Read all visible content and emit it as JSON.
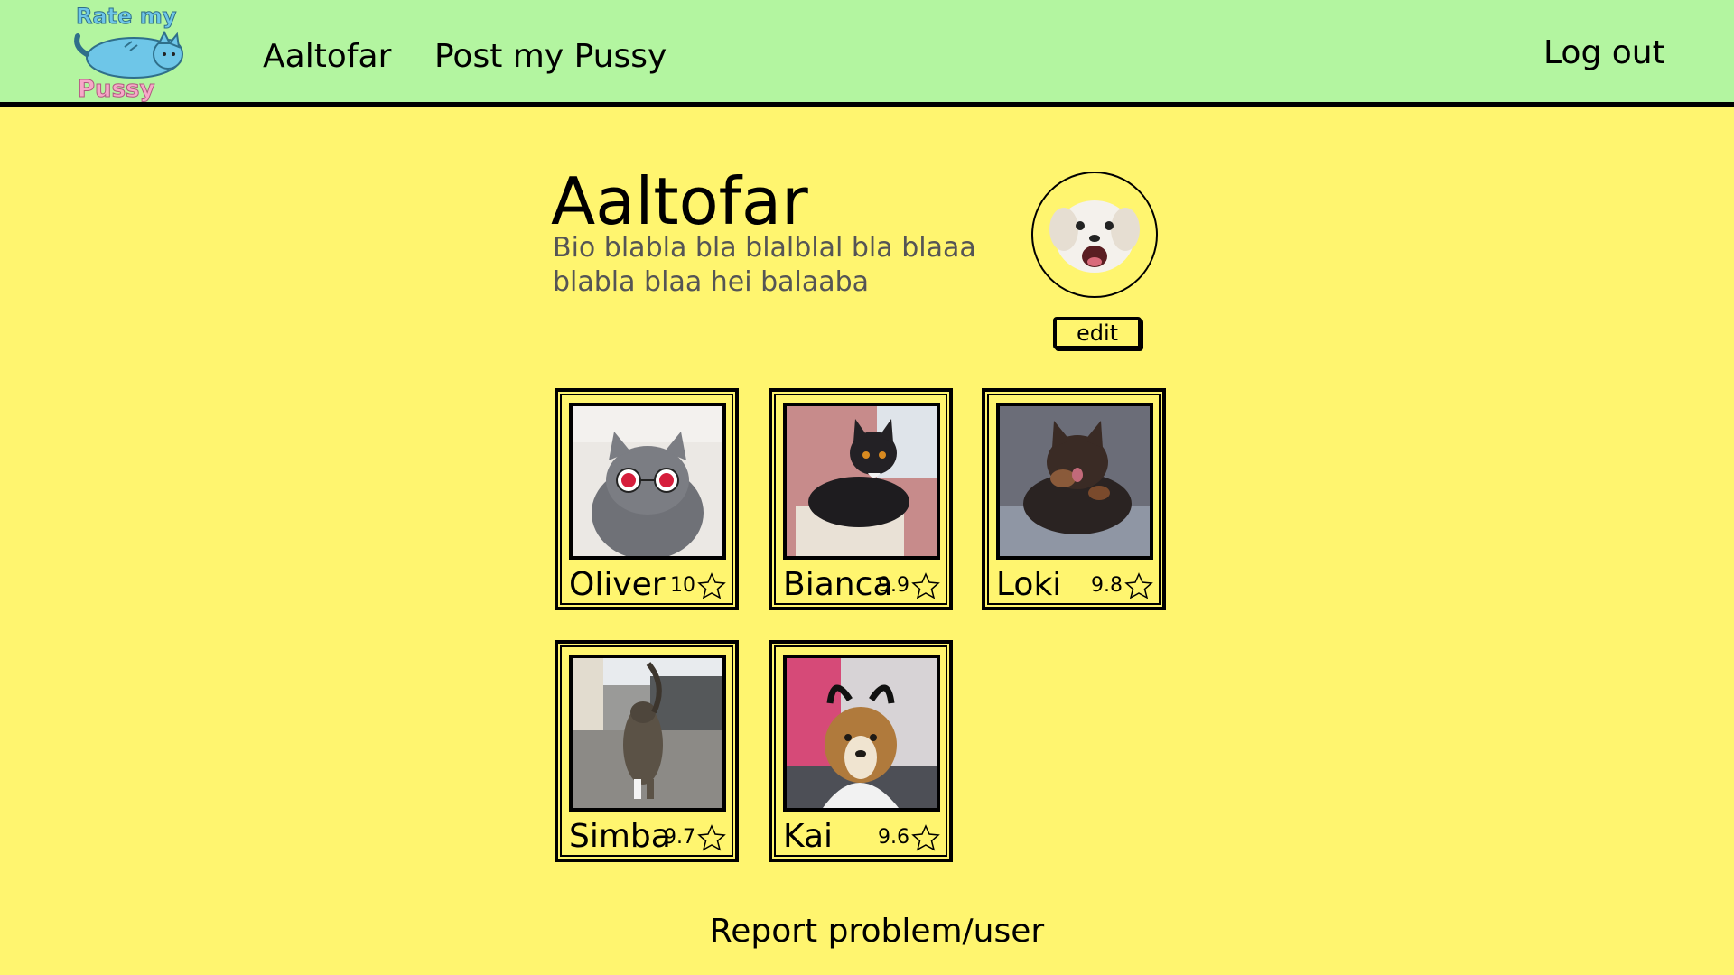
{
  "header": {
    "logo_text_top": "Rate my",
    "logo_text_bottom": "Pussy",
    "user_link": "Aaltofar",
    "post_link": "Post my Pussy",
    "logout_link": "Log out"
  },
  "profile": {
    "name": "Aaltofar",
    "bio_line1": "Bio blabla bla blalblal bla blaaa",
    "bio_line2": "blabla blaa hei balaaba",
    "edit_label": "edit",
    "avatar_icon": "dog-avatar"
  },
  "pets": [
    {
      "name": "Oliver",
      "rating": "10",
      "icon": "cat-with-sunglasses"
    },
    {
      "name": "Bianca",
      "rating": "9.9",
      "icon": "black-cat"
    },
    {
      "name": "Loki",
      "rating": "9.8",
      "icon": "tortoiseshell-cat"
    },
    {
      "name": "Simba",
      "rating": "9.7",
      "icon": "tabby-cat"
    },
    {
      "name": "Kai",
      "rating": "9.6",
      "icon": "dog-with-cat-ears"
    }
  ],
  "footer": {
    "report_link": "Report problem/user"
  },
  "colors": {
    "page_background": "#fff56f",
    "nav_background": "#b3f5a0",
    "logo_blue": "#6ec6e8",
    "logo_pink": "#f7a8c8"
  }
}
